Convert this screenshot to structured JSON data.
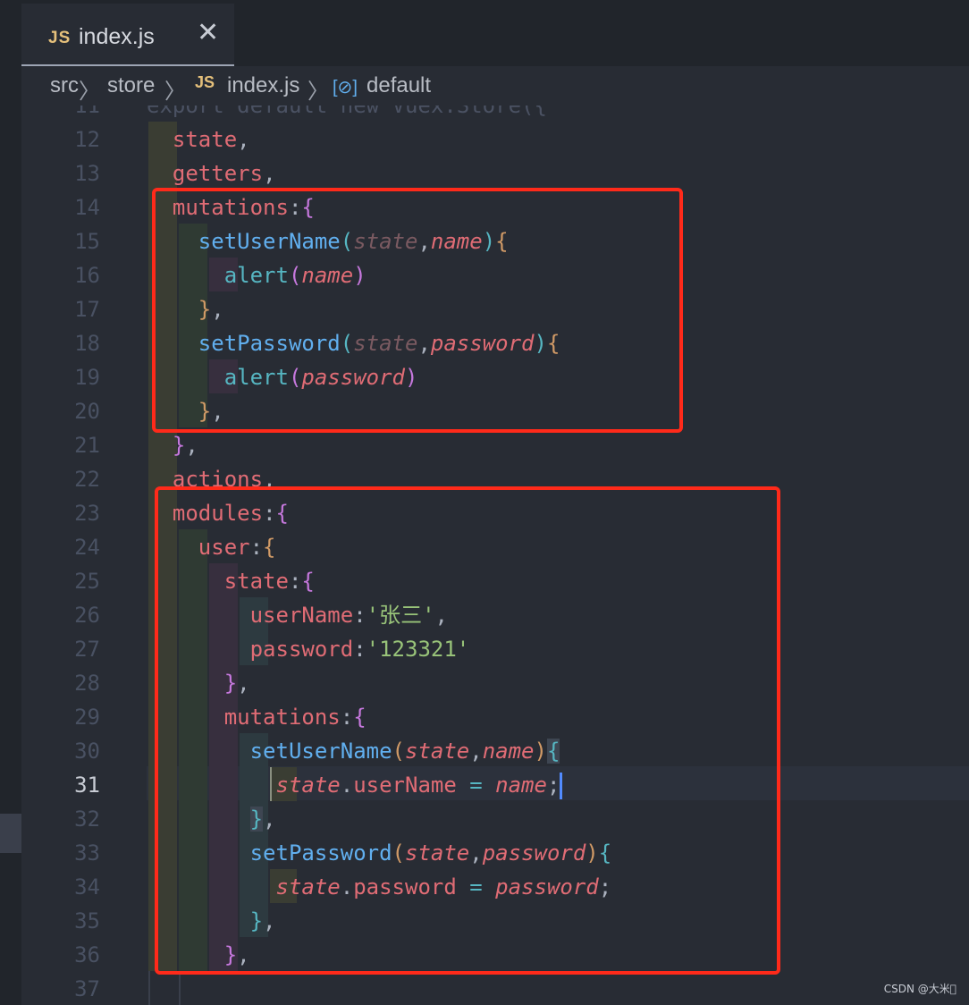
{
  "tab": {
    "badge": "JS",
    "filename": "index.js",
    "close": "✕"
  },
  "breadcrumb": {
    "parts": [
      "src",
      "store"
    ],
    "sep": "〉",
    "file_badge": "JS",
    "file": "index.js",
    "symbol_icon": "[⊘]",
    "symbol": "default"
  },
  "editor": {
    "active_line": 31,
    "top_line_text": "export default new Vuex.Store({",
    "lines": [
      {
        "n": "11"
      },
      {
        "n": "12"
      },
      {
        "n": "13"
      },
      {
        "n": "14"
      },
      {
        "n": "15"
      },
      {
        "n": "16"
      },
      {
        "n": "17"
      },
      {
        "n": "18"
      },
      {
        "n": "19"
      },
      {
        "n": "20"
      },
      {
        "n": "21"
      },
      {
        "n": "22"
      },
      {
        "n": "23"
      },
      {
        "n": "24"
      },
      {
        "n": "25"
      },
      {
        "n": "26"
      },
      {
        "n": "27"
      },
      {
        "n": "28"
      },
      {
        "n": "29"
      },
      {
        "n": "30"
      },
      {
        "n": "31"
      },
      {
        "n": "32"
      },
      {
        "n": "33"
      },
      {
        "n": "34"
      },
      {
        "n": "35"
      },
      {
        "n": "36"
      },
      {
        "n": "37"
      }
    ],
    "tokens": {
      "state": "state",
      "getters": "getters",
      "mutations": "mutations",
      "actions": "actions",
      "modules": "modules",
      "user": "user",
      "userName": "userName",
      "password": "password",
      "setUserName": "setUserName",
      "setPassword": "setPassword",
      "alert": "alert",
      "name": "name",
      "val_name": "'张三'",
      "val_password": "'123321'"
    }
  },
  "watermark": "CSDN @大米\u0000"
}
